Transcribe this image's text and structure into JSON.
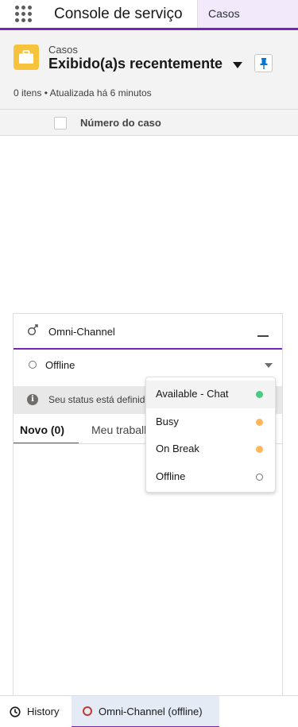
{
  "app": {
    "title": "Console de serviço",
    "tab_label": "Casos"
  },
  "list": {
    "object_label": "Casos",
    "view_title": "Exibido(a)s recentemente",
    "meta": "0 itens • Atualizada há 6 minutos",
    "column_header": "Número do caso"
  },
  "omni": {
    "title": "Omni-Channel",
    "status": "Offline",
    "info": "Seu status está definido como Offline",
    "tabs": [
      "Novo (0)",
      "Meu trabalho"
    ]
  },
  "status_menu": {
    "items": [
      {
        "label": "Available - Chat",
        "color": "#4bca81"
      },
      {
        "label": "Busy",
        "color": "#ffb75d"
      },
      {
        "label": "On Break",
        "color": "#ffb75d"
      },
      {
        "label": "Offline",
        "color": "none"
      }
    ]
  },
  "utility": {
    "history": "History",
    "omni": "Omni-Channel (offline)"
  },
  "colors": {
    "brand": "#7526b9",
    "accent": "#0176d3",
    "object_icon": "#f7c33c"
  },
  "icons": [
    "app-launcher-icon",
    "case-icon",
    "pin-icon",
    "omni-channel-icon",
    "minimize-icon",
    "info-icon",
    "history-icon"
  ]
}
